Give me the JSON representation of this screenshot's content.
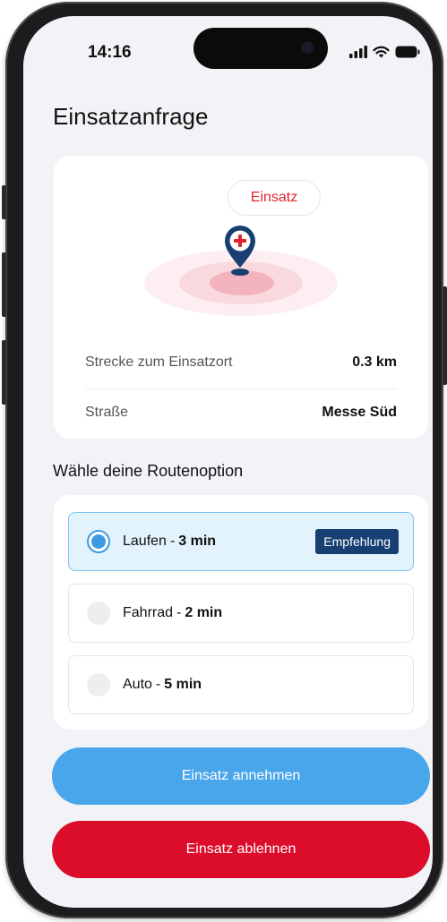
{
  "status_bar": {
    "time": "14:16"
  },
  "page": {
    "title": "Einsatzanfrage"
  },
  "map_card": {
    "badge": "Einsatz",
    "rows": [
      {
        "label": "Strecke zum Einsatzort",
        "value": "0.3 km"
      },
      {
        "label": "Straße",
        "value": "Messe Süd"
      }
    ]
  },
  "route_section": {
    "title": "Wähle deine Routenoption"
  },
  "route_options": [
    {
      "name": "Laufen",
      "sep": "-",
      "time": "3 min",
      "selected": true,
      "badge": "Empfehlung"
    },
    {
      "name": "Fahrrad",
      "sep": "-",
      "time": "2 min",
      "selected": false
    },
    {
      "name": "Auto",
      "sep": "-",
      "time": "5 min",
      "selected": false
    }
  ],
  "actions": {
    "accept_label": "Einsatz annehmen",
    "decline_label": "Einsatz ablehnen"
  },
  "icons": [
    "signal-icon",
    "wifi-icon",
    "battery-icon",
    "location-pin-icon"
  ],
  "colors": {
    "accent_blue": "#4aa6ea",
    "selected_radio": "#3c9be3",
    "decline_red": "#dc0c2b",
    "badge_red": "#e0242e",
    "recommendation_bg": "#173f72",
    "pin_navy": "#173f72"
  }
}
